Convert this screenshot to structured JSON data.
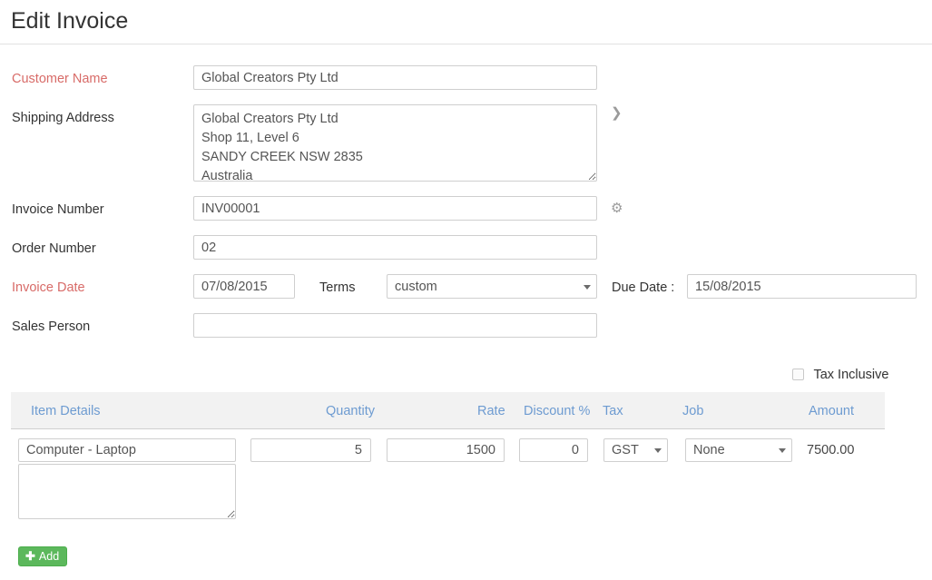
{
  "header": {
    "title": "Edit Invoice"
  },
  "form": {
    "customer_name": {
      "label": "Customer Name",
      "required": true,
      "value": "Global Creators Pty Ltd",
      "placeholder": ""
    },
    "shipping_address": {
      "label": "Shipping Address",
      "required": false,
      "value": "Global Creators Pty Ltd\nShop 11, Level 6\nSANDY CREEK NSW 2835\nAustralia",
      "placeholder": "",
      "expand_icon": "chevron-down-icon"
    },
    "invoice_number": {
      "label": "Invoice Number",
      "required": false,
      "value": "INV00001",
      "placeholder": "",
      "settings_icon": "gear-icon"
    },
    "order_number": {
      "label": "Order Number",
      "required": false,
      "value": "02",
      "placeholder": ""
    },
    "invoice_date": {
      "label": "Invoice Date",
      "required": true,
      "value": "07/08/2015",
      "placeholder": ""
    },
    "terms": {
      "label": "Terms",
      "value": "custom",
      "options": [
        "custom"
      ]
    },
    "due_date": {
      "label": "Due Date :",
      "value": "15/08/2015",
      "placeholder": ""
    },
    "sales_person": {
      "label": "Sales Person",
      "required": false,
      "value": "",
      "placeholder": ""
    }
  },
  "tax_inclusive": {
    "label": "Tax Inclusive",
    "checked": false
  },
  "items_table": {
    "columns": [
      "Item Details",
      "Quantity",
      "Rate",
      "Discount %",
      "Tax",
      "Job",
      "Amount"
    ],
    "rows": [
      {
        "item_name": "Computer - Laptop",
        "item_description": "",
        "quantity": "5",
        "rate": "1500",
        "discount": "0",
        "tax": "GST",
        "tax_options": [
          "GST"
        ],
        "job": "None",
        "job_options": [
          "None"
        ],
        "amount": "7500.00"
      }
    ]
  },
  "actions": {
    "add_label": "Add",
    "add_icon": "plus-icon"
  },
  "colors": {
    "required_label": "#d86b68",
    "table_header_text": "#6d9bd1",
    "table_header_bg": "#f2f2f2",
    "add_button": "#5cb85c",
    "border": "#cfcfcf"
  }
}
